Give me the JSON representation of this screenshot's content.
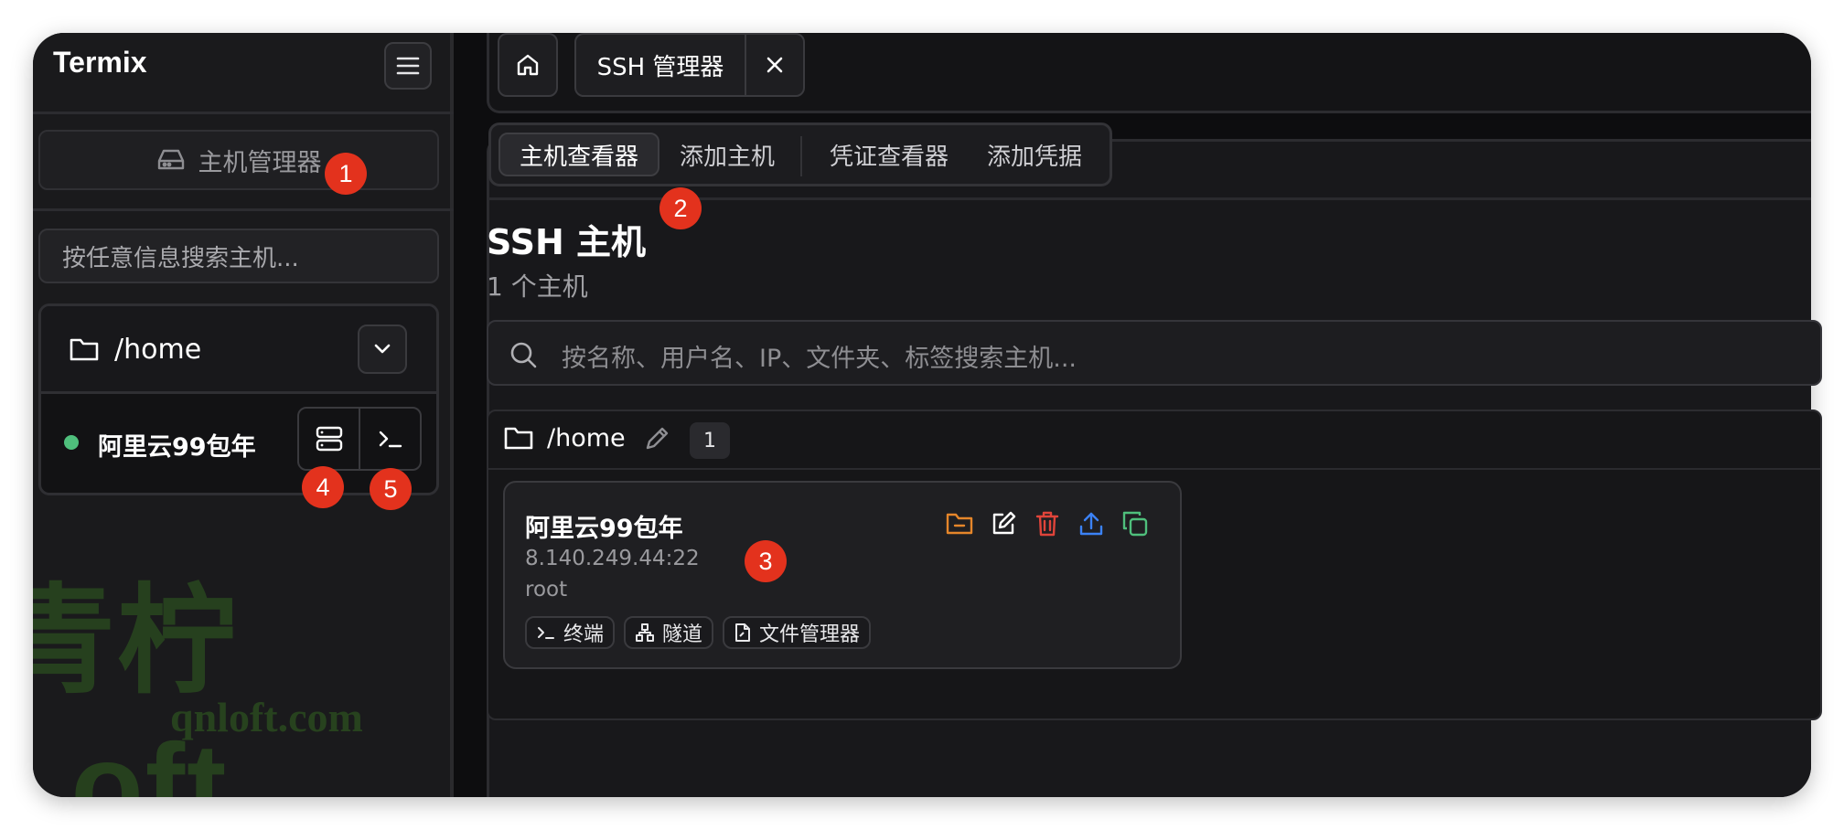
{
  "sidebar": {
    "brand": "Termix",
    "host_manager_label": "主机管理器",
    "search_placeholder": "按任意信息搜索主机...",
    "folder_name": "/home",
    "host": {
      "name": "阿里云99包年",
      "status": "online",
      "status_color": "#4fbf7c"
    }
  },
  "watermark": {
    "main": "青柠Loft",
    "site": "qnloft.com"
  },
  "tabs": {
    "home_icon": "home-icon",
    "active_tab_label": "SSH 管理器"
  },
  "subtabs": [
    "主机查看器",
    "添加主机",
    "凭证查看器",
    "添加凭据"
  ],
  "main": {
    "title": "SSH 主机",
    "subtitle": "1 个主机",
    "search_placeholder": "按名称、用户名、IP、文件夹、标签搜索主机...",
    "group": {
      "name": "/home",
      "count": "1"
    },
    "card": {
      "name": "阿里云99包年",
      "address": "8.140.249.44:22",
      "user": "root",
      "chips": [
        "终端",
        "隧道",
        "文件管理器"
      ],
      "action_icons": [
        "folder-minus-icon",
        "edit-icon",
        "trash-icon",
        "upload-icon",
        "copy-icon"
      ]
    }
  },
  "badges": [
    "1",
    "2",
    "3",
    "4",
    "5"
  ],
  "colors": {
    "accent_orange": "#e5862a",
    "danger": "#e0443a",
    "info": "#3b82f6",
    "success": "#4fbf7c",
    "badge": "#e3321d"
  }
}
